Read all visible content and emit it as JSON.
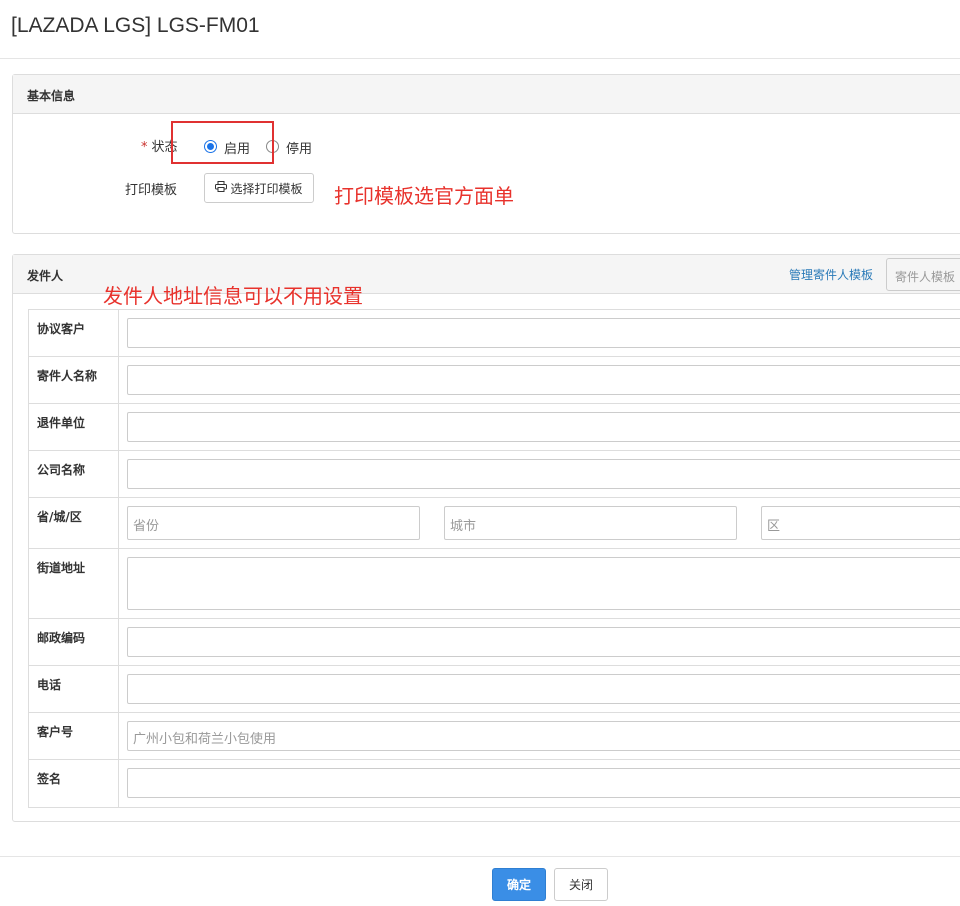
{
  "window": {
    "title": "[LAZADA LGS] LGS-FM01"
  },
  "basic_info": {
    "heading": "基本信息",
    "status": {
      "required_mark": "*",
      "label": "状态",
      "options": [
        "启用",
        "停用"
      ],
      "selected": "启用"
    },
    "print_template": {
      "label": "打印模板",
      "button_label": "选择打印模板",
      "button_icon": "printer-icon"
    },
    "annotation": "打印模板选官方面单"
  },
  "sender": {
    "heading": "发件人",
    "annotation": "发件人地址信息可以不用设置",
    "manage_link": "管理寄件人模板",
    "template_select_placeholder": "寄件人模板",
    "fields": {
      "agreement_customer": {
        "label": "协议客户",
        "value": ""
      },
      "sender_name": {
        "label": "寄件人名称",
        "value": ""
      },
      "return_unit": {
        "label": "退件单位",
        "value": ""
      },
      "company_name": {
        "label": "公司名称",
        "value": ""
      },
      "region": {
        "label": "省/城/区",
        "province_placeholder": "省份",
        "city_placeholder": "城市",
        "district_placeholder": "区"
      },
      "street": {
        "label": "街道地址",
        "value": ""
      },
      "postcode": {
        "label": "邮政编码",
        "value": ""
      },
      "phone": {
        "label": "电话",
        "value": ""
      },
      "customer_no": {
        "label": "客户号",
        "placeholder": "广州小包和荷兰小包使用"
      },
      "signature": {
        "label": "签名",
        "value": ""
      }
    }
  },
  "footer": {
    "confirm_label": "确定",
    "close_label": "关闭"
  },
  "colors": {
    "primary": "#3a8ee6",
    "annotation_red": "#e8322c",
    "link": "#2a7ab8"
  }
}
